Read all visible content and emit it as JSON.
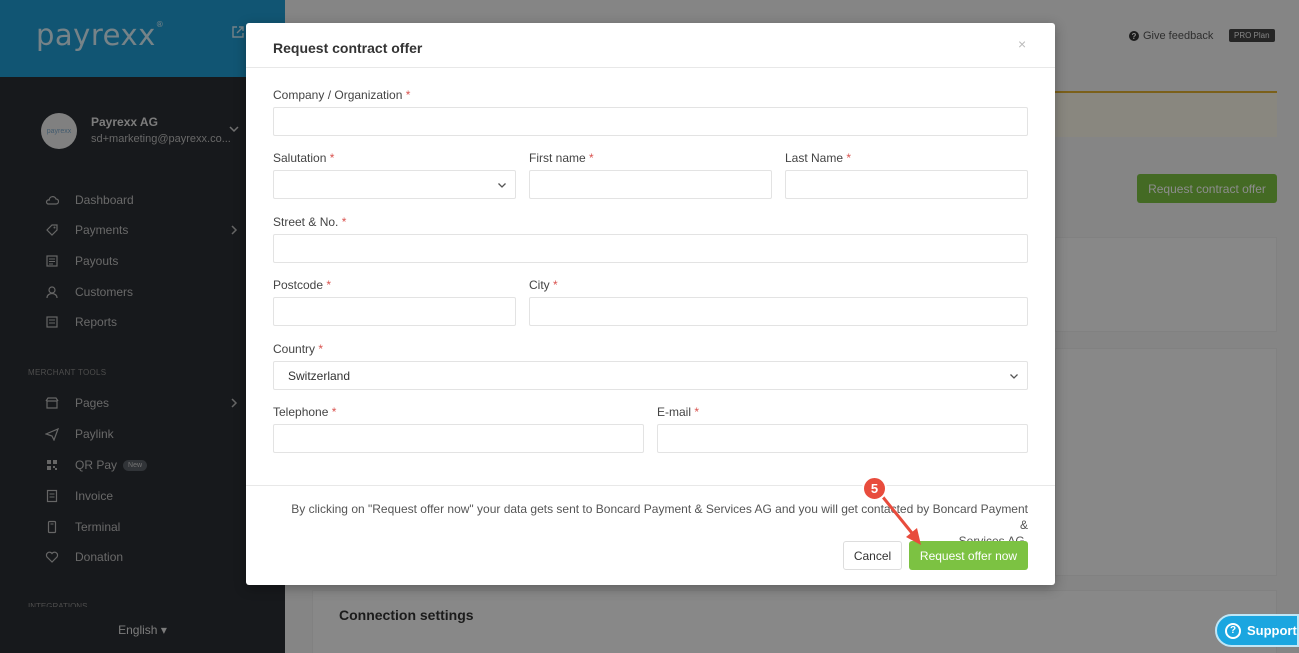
{
  "sidebar": {
    "logo": "payrexx",
    "account": {
      "avatar_text": "payrexx",
      "name": "Payrexx AG",
      "email": "sd+marketing@payrexx.co..."
    },
    "items": [
      {
        "label": "Dashboard",
        "icon": "cloud-icon"
      },
      {
        "label": "Payments",
        "icon": "tag-icon"
      },
      {
        "label": "Payouts",
        "icon": "payouts-icon"
      },
      {
        "label": "Customers",
        "icon": "user-icon"
      },
      {
        "label": "Reports",
        "icon": "report-icon"
      }
    ],
    "merchant_tools_title": "MERCHANT TOOLS",
    "tools": [
      {
        "label": "Pages",
        "icon": "store-icon"
      },
      {
        "label": "Paylink",
        "icon": "send-icon"
      },
      {
        "label": "QR Pay",
        "icon": "qr-icon",
        "badge": "New"
      },
      {
        "label": "Invoice",
        "icon": "invoice-icon"
      },
      {
        "label": "Terminal",
        "icon": "terminal-icon"
      },
      {
        "label": "Donation",
        "icon": "heart-icon"
      }
    ],
    "integrations_title": "INTEGRATIONS",
    "language": "English"
  },
  "header": {
    "feedback": "Give feedback",
    "plan": "PRO Plan"
  },
  "background": {
    "request_button": "Request contract offer",
    "connection_title": "Connection settings"
  },
  "modal": {
    "title": "Request contract offer",
    "close": "×",
    "fields": {
      "company": {
        "label": "Company / Organization",
        "value": ""
      },
      "salutation": {
        "label": "Salutation",
        "value": ""
      },
      "first_name": {
        "label": "First name",
        "value": ""
      },
      "last_name": {
        "label": "Last Name",
        "value": ""
      },
      "street": {
        "label": "Street & No.",
        "value": ""
      },
      "postcode": {
        "label": "Postcode",
        "value": ""
      },
      "city": {
        "label": "City",
        "value": ""
      },
      "country": {
        "label": "Country",
        "value": "Switzerland"
      },
      "telephone": {
        "label": "Telephone",
        "value": ""
      },
      "email": {
        "label": "E-mail",
        "value": ""
      }
    },
    "required_mark": "*",
    "footer_text_line1": "By clicking on \"Request offer now\" your data gets sent to Boncard Payment & Services AG and you will get contacted by Boncard Payment &",
    "footer_text_line2": "Services AG.",
    "cancel": "Cancel",
    "submit": "Request offer now"
  },
  "annotation": {
    "step": "5",
    "color": "#e84c3d"
  },
  "support": {
    "label": "Support"
  },
  "colors": {
    "brand_blue": "#1f9bd1",
    "accent_green": "#7cc242",
    "sidebar_bg": "#2b2e33"
  }
}
